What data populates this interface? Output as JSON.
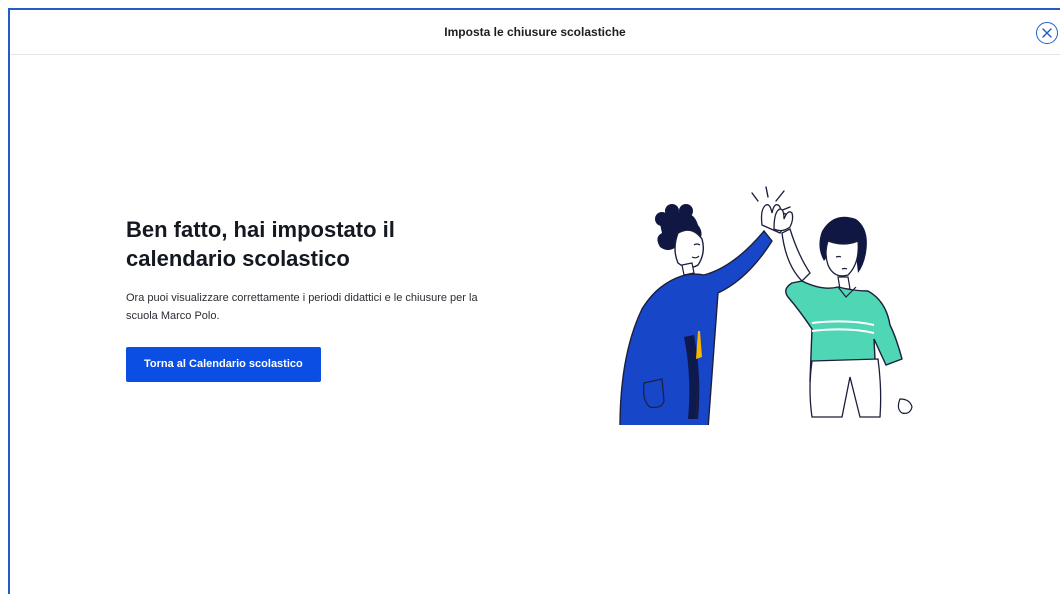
{
  "modal": {
    "title": "Imposta le chiusure scolastiche",
    "close_icon": "close-circle-icon"
  },
  "success": {
    "headline_line1": "Ben fatto, hai impostato il",
    "headline_line2": "calendario scolastico",
    "description_line1": "Ora puoi visualizzare correttamente i periodi didattici e le chiusure per la",
    "description_line2": "scuola Marco Polo.",
    "button_label": "Torna al Calendario scolastico"
  },
  "illustration": {
    "name": "high-five-illustration"
  },
  "colors": {
    "accent": "#0a4ee4",
    "border": "#1f5fc4",
    "coat_blue": "#1846c9",
    "shirt_teal": "#4fd6b4"
  }
}
